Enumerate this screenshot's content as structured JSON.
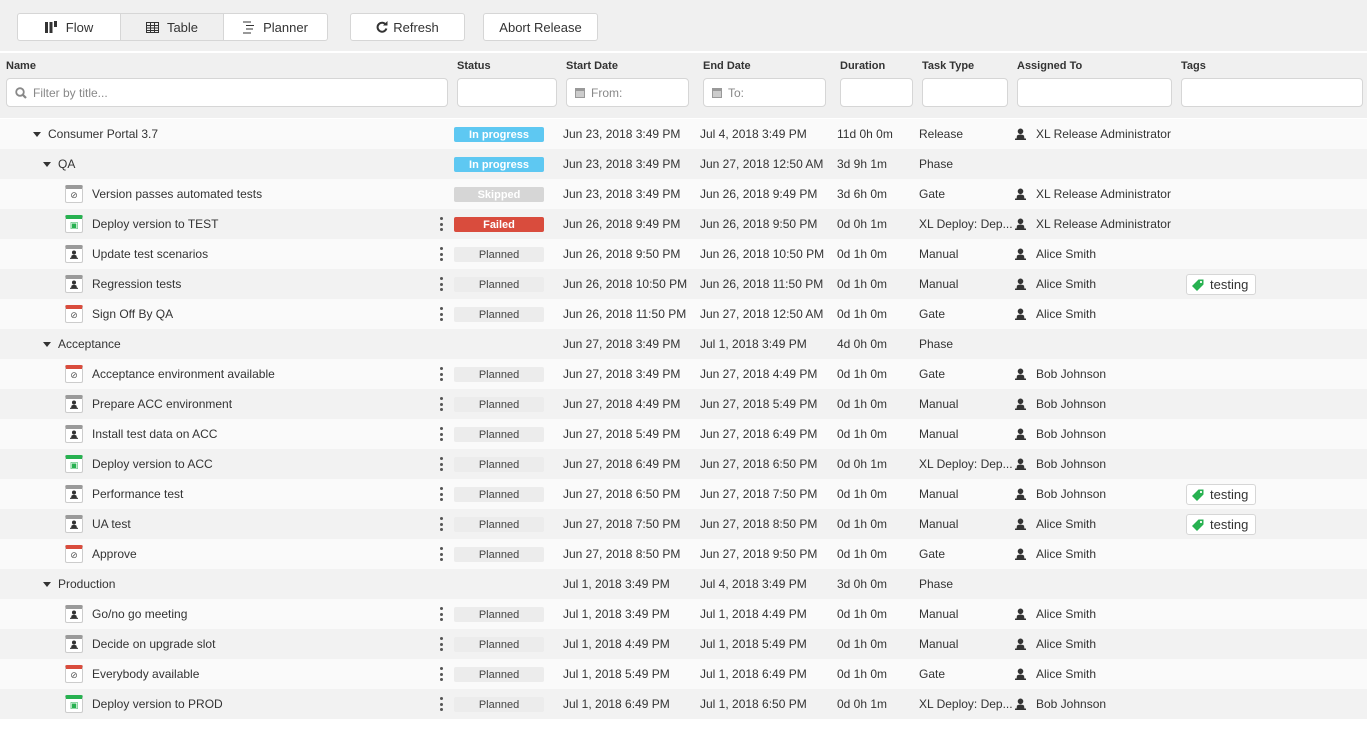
{
  "toolbar": {
    "view_buttons": [
      {
        "label": "Flow",
        "icon": "flow-icon",
        "active": false
      },
      {
        "label": "Table",
        "icon": "table-icon",
        "active": true
      },
      {
        "label": "Planner",
        "icon": "planner-icon",
        "active": false
      }
    ],
    "refresh_label": "Refresh",
    "abort_label": "Abort Release"
  },
  "filters": {
    "name": {
      "label": "Name",
      "placeholder": "Filter by title..."
    },
    "status": {
      "label": "Status",
      "value": ""
    },
    "start_date": {
      "label": "Start Date",
      "placeholder": "From:"
    },
    "end_date": {
      "label": "End Date",
      "placeholder": "To:"
    },
    "duration": {
      "label": "Duration",
      "value": ""
    },
    "task_type": {
      "label": "Task Type",
      "value": ""
    },
    "assigned_to": {
      "label": "Assigned To",
      "value": ""
    },
    "tags": {
      "label": "Tags",
      "value": ""
    }
  },
  "colors": {
    "in_progress": "#5ec8f2",
    "skipped": "#d6d6d6",
    "failed": "#d94c3d",
    "planned": "#ececec",
    "gate": "#d94c3d",
    "deploy": "#27b150",
    "manual": "#9a9a9a"
  },
  "rows": [
    {
      "level": 0,
      "kind": "group",
      "name": "Consumer Portal 3.7",
      "status": "In progress",
      "status_kind": "in_progress",
      "start": "Jun 23, 2018 3:49 PM",
      "end": "Jul 4, 2018 3:49 PM",
      "duration": "11d 0h 0m",
      "type": "Release",
      "assignee": "XL Release Administrator",
      "tag": ""
    },
    {
      "level": 1,
      "kind": "group",
      "name": "QA",
      "status": "In progress",
      "status_kind": "in_progress",
      "start": "Jun 23, 2018 3:49 PM",
      "end": "Jun 27, 2018 12:50 AM",
      "duration": "3d 9h 1m",
      "type": "Phase",
      "assignee": "",
      "tag": ""
    },
    {
      "level": 2,
      "kind": "gate",
      "name": "Version passes automated tests",
      "status": "Skipped",
      "status_kind": "skipped",
      "start": "Jun 23, 2018 3:49 PM",
      "end": "Jun 26, 2018 9:49 PM",
      "duration": "3d 6h 0m",
      "type": "Gate",
      "assignee": "XL Release Administrator",
      "tag": "",
      "menu": false,
      "icon_color": "manual"
    },
    {
      "level": 2,
      "kind": "deploy",
      "name": "Deploy version to TEST",
      "status": "Failed",
      "status_kind": "failed",
      "start": "Jun 26, 2018 9:49 PM",
      "end": "Jun 26, 2018 9:50 PM",
      "duration": "0d 0h 1m",
      "type": "XL Deploy: Dep...",
      "assignee": "XL Release Administrator",
      "tag": "",
      "menu": true
    },
    {
      "level": 2,
      "kind": "manual",
      "name": "Update test scenarios",
      "status": "Planned",
      "status_kind": "planned",
      "start": "Jun 26, 2018 9:50 PM",
      "end": "Jun 26, 2018 10:50 PM",
      "duration": "0d 1h 0m",
      "type": "Manual",
      "assignee": "Alice Smith",
      "tag": "",
      "menu": true
    },
    {
      "level": 2,
      "kind": "manual",
      "name": "Regression tests",
      "status": "Planned",
      "status_kind": "planned",
      "start": "Jun 26, 2018 10:50 PM",
      "end": "Jun 26, 2018 11:50 PM",
      "duration": "0d 1h 0m",
      "type": "Manual",
      "assignee": "Alice Smith",
      "tag": "testing",
      "menu": true
    },
    {
      "level": 2,
      "kind": "gate",
      "name": "Sign Off By QA",
      "status": "Planned",
      "status_kind": "planned",
      "start": "Jun 26, 2018 11:50 PM",
      "end": "Jun 27, 2018 12:50 AM",
      "duration": "0d 1h 0m",
      "type": "Gate",
      "assignee": "Alice Smith",
      "tag": "",
      "menu": true
    },
    {
      "level": 1,
      "kind": "group",
      "name": "Acceptance",
      "status": "",
      "status_kind": "",
      "start": "Jun 27, 2018 3:49 PM",
      "end": "Jul 1, 2018 3:49 PM",
      "duration": "4d 0h 0m",
      "type": "Phase",
      "assignee": "",
      "tag": ""
    },
    {
      "level": 2,
      "kind": "gate",
      "name": "Acceptance environment available",
      "status": "Planned",
      "status_kind": "planned",
      "start": "Jun 27, 2018 3:49 PM",
      "end": "Jun 27, 2018 4:49 PM",
      "duration": "0d 1h 0m",
      "type": "Gate",
      "assignee": "Bob Johnson",
      "tag": "",
      "menu": true
    },
    {
      "level": 2,
      "kind": "manual",
      "name": "Prepare ACC environment",
      "status": "Planned",
      "status_kind": "planned",
      "start": "Jun 27, 2018 4:49 PM",
      "end": "Jun 27, 2018 5:49 PM",
      "duration": "0d 1h 0m",
      "type": "Manual",
      "assignee": "Bob Johnson",
      "tag": "",
      "menu": true
    },
    {
      "level": 2,
      "kind": "manual",
      "name": "Install test data on ACC",
      "status": "Planned",
      "status_kind": "planned",
      "start": "Jun 27, 2018 5:49 PM",
      "end": "Jun 27, 2018 6:49 PM",
      "duration": "0d 1h 0m",
      "type": "Manual",
      "assignee": "Bob Johnson",
      "tag": "",
      "menu": true
    },
    {
      "level": 2,
      "kind": "deploy",
      "name": "Deploy version to ACC",
      "status": "Planned",
      "status_kind": "planned",
      "start": "Jun 27, 2018 6:49 PM",
      "end": "Jun 27, 2018 6:50 PM",
      "duration": "0d 0h 1m",
      "type": "XL Deploy: Dep...",
      "assignee": "Bob Johnson",
      "tag": "",
      "menu": true
    },
    {
      "level": 2,
      "kind": "manual",
      "name": "Performance test",
      "status": "Planned",
      "status_kind": "planned",
      "start": "Jun 27, 2018 6:50 PM",
      "end": "Jun 27, 2018 7:50 PM",
      "duration": "0d 1h 0m",
      "type": "Manual",
      "assignee": "Bob Johnson",
      "tag": "testing",
      "menu": true
    },
    {
      "level": 2,
      "kind": "manual",
      "name": "UA test",
      "status": "Planned",
      "status_kind": "planned",
      "start": "Jun 27, 2018 7:50 PM",
      "end": "Jun 27, 2018 8:50 PM",
      "duration": "0d 1h 0m",
      "type": "Manual",
      "assignee": "Alice Smith",
      "tag": "testing",
      "menu": true
    },
    {
      "level": 2,
      "kind": "gate",
      "name": "Approve",
      "status": "Planned",
      "status_kind": "planned",
      "start": "Jun 27, 2018 8:50 PM",
      "end": "Jun 27, 2018 9:50 PM",
      "duration": "0d 1h 0m",
      "type": "Gate",
      "assignee": "Alice Smith",
      "tag": "",
      "menu": true
    },
    {
      "level": 1,
      "kind": "group",
      "name": "Production",
      "status": "",
      "status_kind": "",
      "start": "Jul 1, 2018 3:49 PM",
      "end": "Jul 4, 2018 3:49 PM",
      "duration": "3d 0h 0m",
      "type": "Phase",
      "assignee": "",
      "tag": ""
    },
    {
      "level": 2,
      "kind": "manual",
      "name": "Go/no go meeting",
      "status": "Planned",
      "status_kind": "planned",
      "start": "Jul 1, 2018 3:49 PM",
      "end": "Jul 1, 2018 4:49 PM",
      "duration": "0d 1h 0m",
      "type": "Manual",
      "assignee": "Alice Smith",
      "tag": "",
      "menu": true
    },
    {
      "level": 2,
      "kind": "manual",
      "name": "Decide on upgrade slot",
      "status": "Planned",
      "status_kind": "planned",
      "start": "Jul 1, 2018 4:49 PM",
      "end": "Jul 1, 2018 5:49 PM",
      "duration": "0d 1h 0m",
      "type": "Manual",
      "assignee": "Alice Smith",
      "tag": "",
      "menu": true
    },
    {
      "level": 2,
      "kind": "gate",
      "name": "Everybody available",
      "status": "Planned",
      "status_kind": "planned",
      "start": "Jul 1, 2018 5:49 PM",
      "end": "Jul 1, 2018 6:49 PM",
      "duration": "0d 1h 0m",
      "type": "Gate",
      "assignee": "Alice Smith",
      "tag": "",
      "menu": true
    },
    {
      "level": 2,
      "kind": "deploy",
      "name": "Deploy version to PROD",
      "status": "Planned",
      "status_kind": "planned",
      "start": "Jul 1, 2018 6:49 PM",
      "end": "Jul 1, 2018 6:50 PM",
      "duration": "0d 0h 1m",
      "type": "XL Deploy: Dep...",
      "assignee": "Bob Johnson",
      "tag": "",
      "menu": true
    }
  ]
}
